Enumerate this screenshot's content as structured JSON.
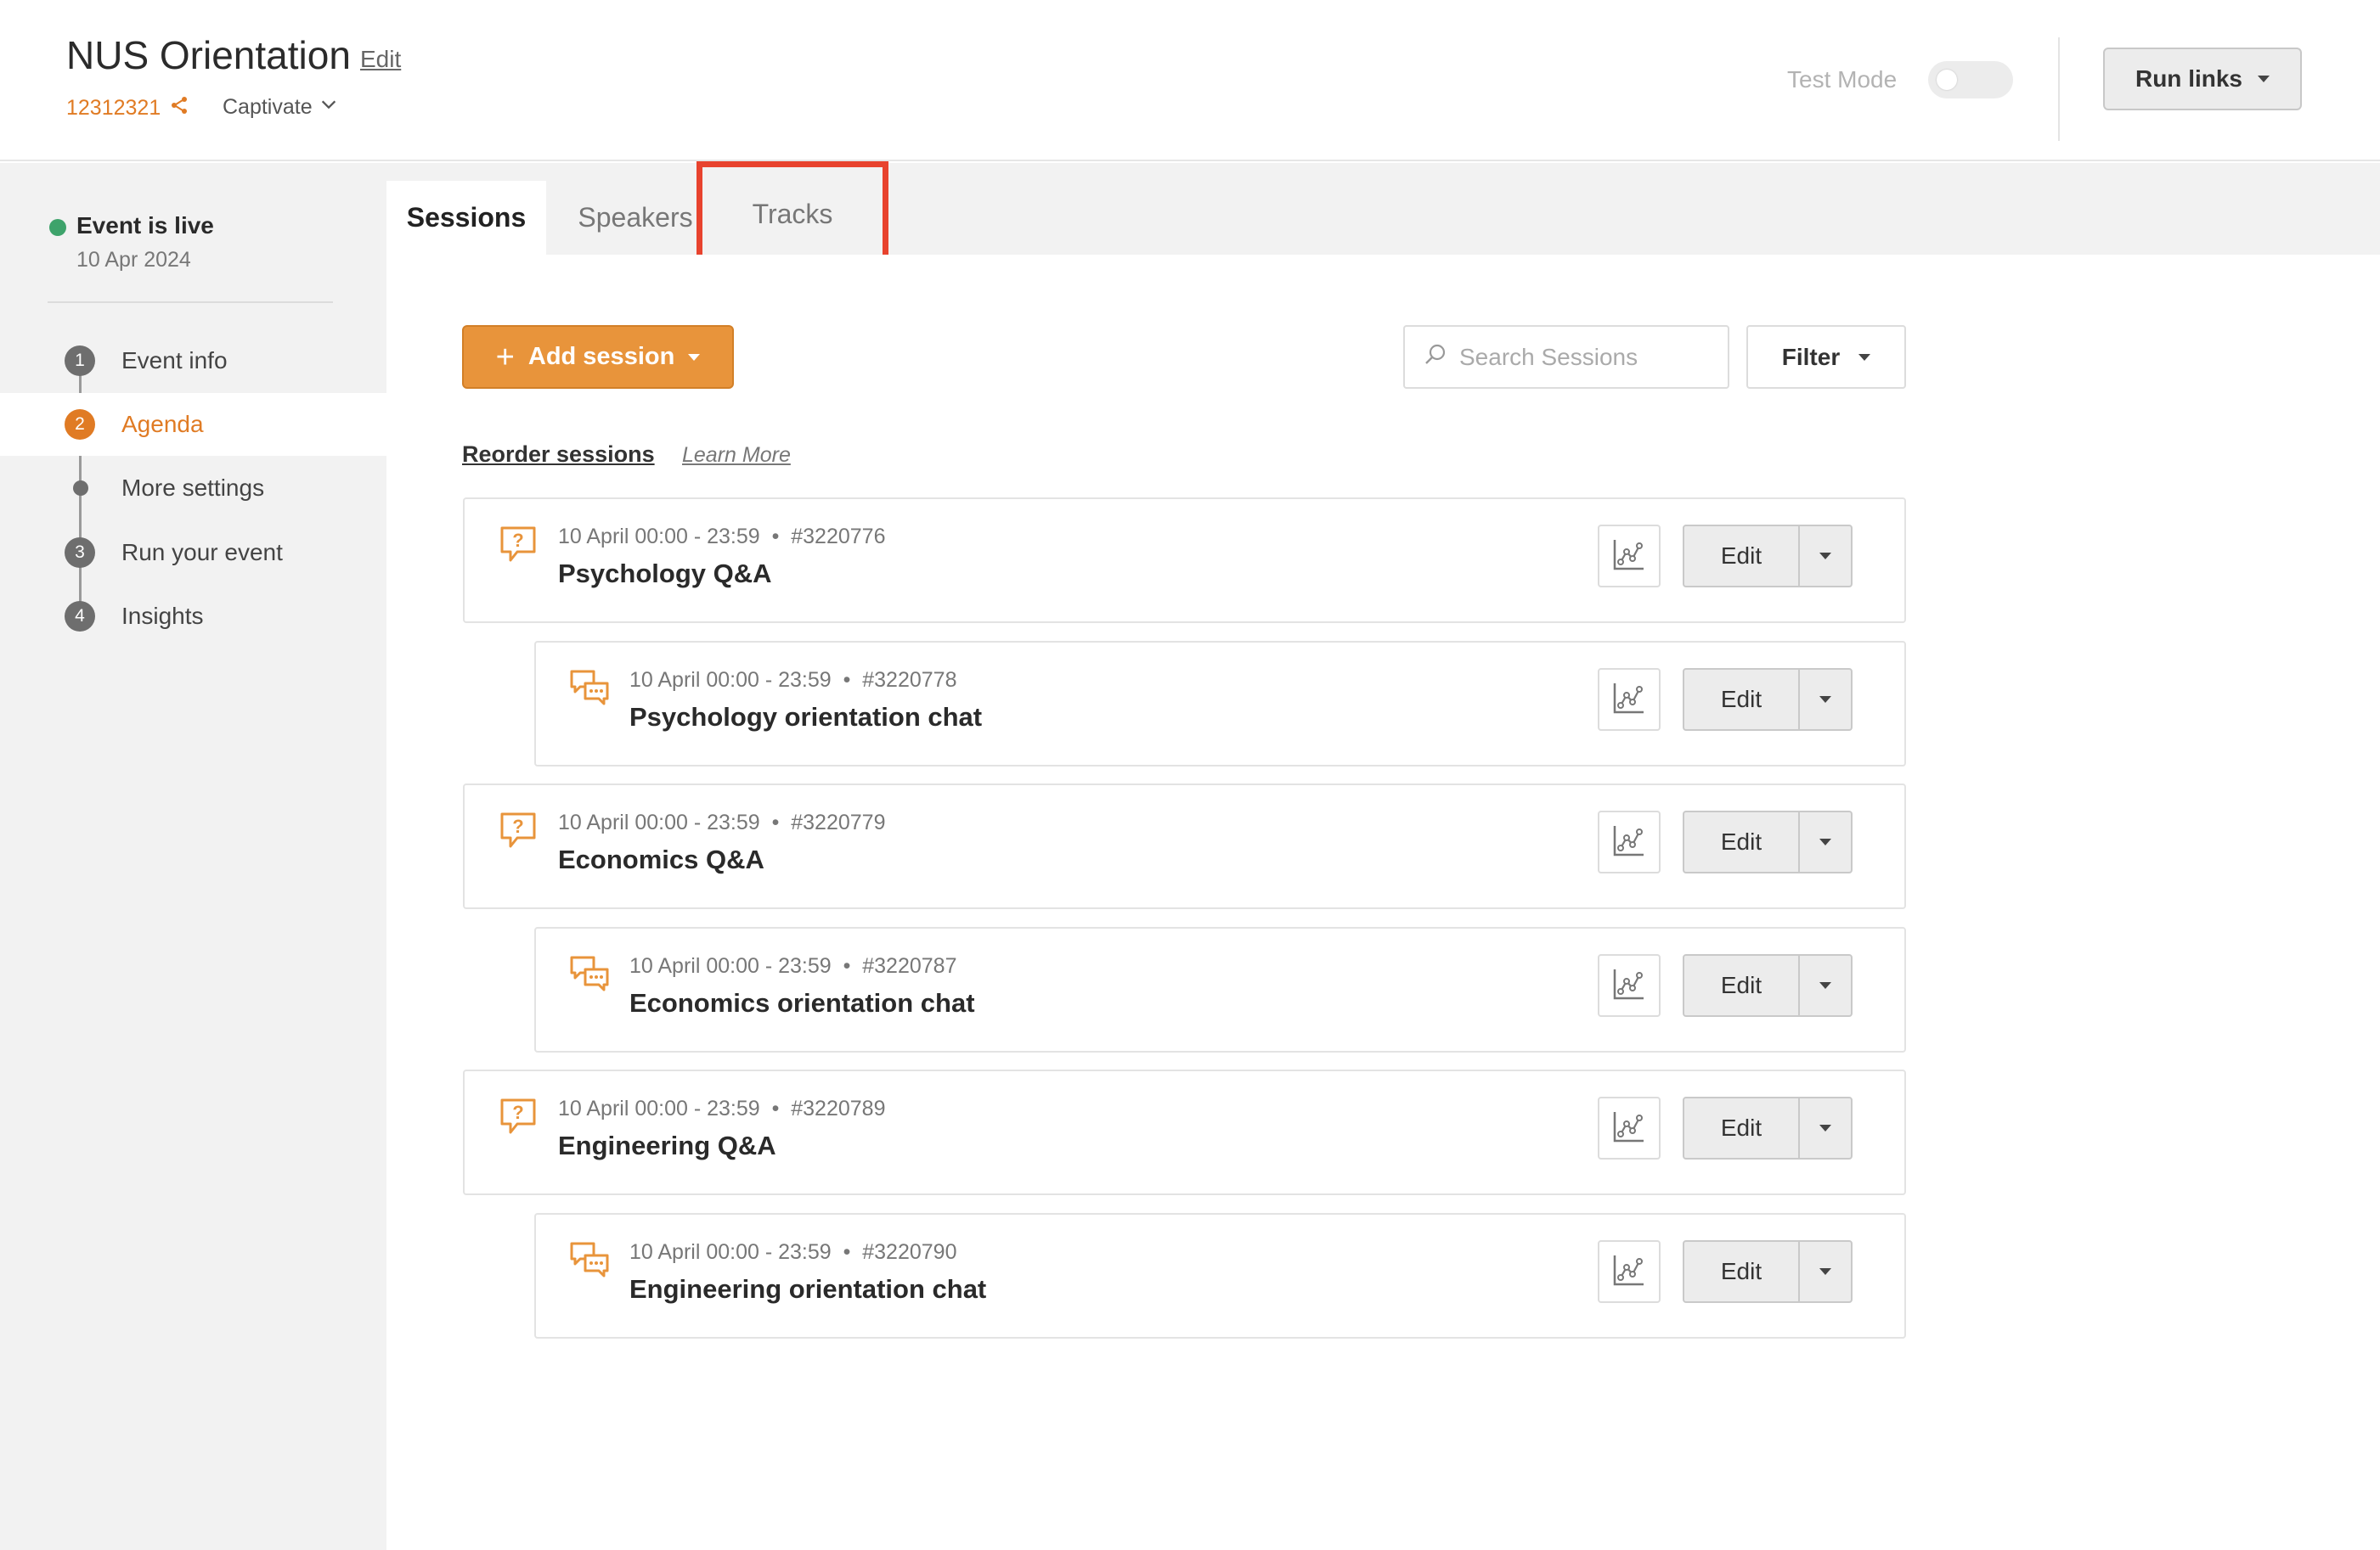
{
  "header": {
    "title": "NUS Orientation",
    "edit_label": "Edit",
    "event_id": "12312321",
    "product": "Captivate",
    "test_mode_label": "Test Mode",
    "run_links_label": "Run links"
  },
  "sidebar": {
    "status": "Event is live",
    "date": "10 Apr 2024",
    "items": [
      {
        "badge": "1",
        "label": "Event info"
      },
      {
        "badge": "2",
        "label": "Agenda"
      },
      {
        "badge": "",
        "label": "More settings"
      },
      {
        "badge": "3",
        "label": "Run your event"
      },
      {
        "badge": "4",
        "label": "Insights"
      }
    ]
  },
  "tabs": [
    {
      "label": "Sessions"
    },
    {
      "label": "Speakers"
    },
    {
      "label": "Tracks"
    }
  ],
  "toolbar": {
    "add_session_label": "Add session",
    "search_placeholder": "Search Sessions",
    "filter_label": "Filter",
    "reorder_label": "Reorder sessions",
    "learn_more_label": "Learn More"
  },
  "sessions": [
    {
      "type": "qa",
      "time": "10 April 00:00 - 23:59",
      "id": "#3220776",
      "title": "Psychology Q&A",
      "edit": "Edit"
    },
    {
      "type": "chat",
      "time": "10 April 00:00 - 23:59",
      "id": "#3220778",
      "title": "Psychology orientation chat",
      "edit": "Edit"
    },
    {
      "type": "qa",
      "time": "10 April 00:00 - 23:59",
      "id": "#3220779",
      "title": "Economics Q&A",
      "edit": "Edit"
    },
    {
      "type": "chat",
      "time": "10 April 00:00 - 23:59",
      "id": "#3220787",
      "title": "Economics orientation chat",
      "edit": "Edit"
    },
    {
      "type": "qa",
      "time": "10 April 00:00 - 23:59",
      "id": "#3220789",
      "title": "Engineering Q&A",
      "edit": "Edit"
    },
    {
      "type": "chat",
      "time": "10 April 00:00 - 23:59",
      "id": "#3220790",
      "title": "Engineering orientation chat",
      "edit": "Edit"
    }
  ],
  "meta_separator": "•",
  "colors": {
    "accent": "#e07b24",
    "add_button": "#e8943b",
    "live": "#3ea36b",
    "highlight": "#e8432e"
  }
}
